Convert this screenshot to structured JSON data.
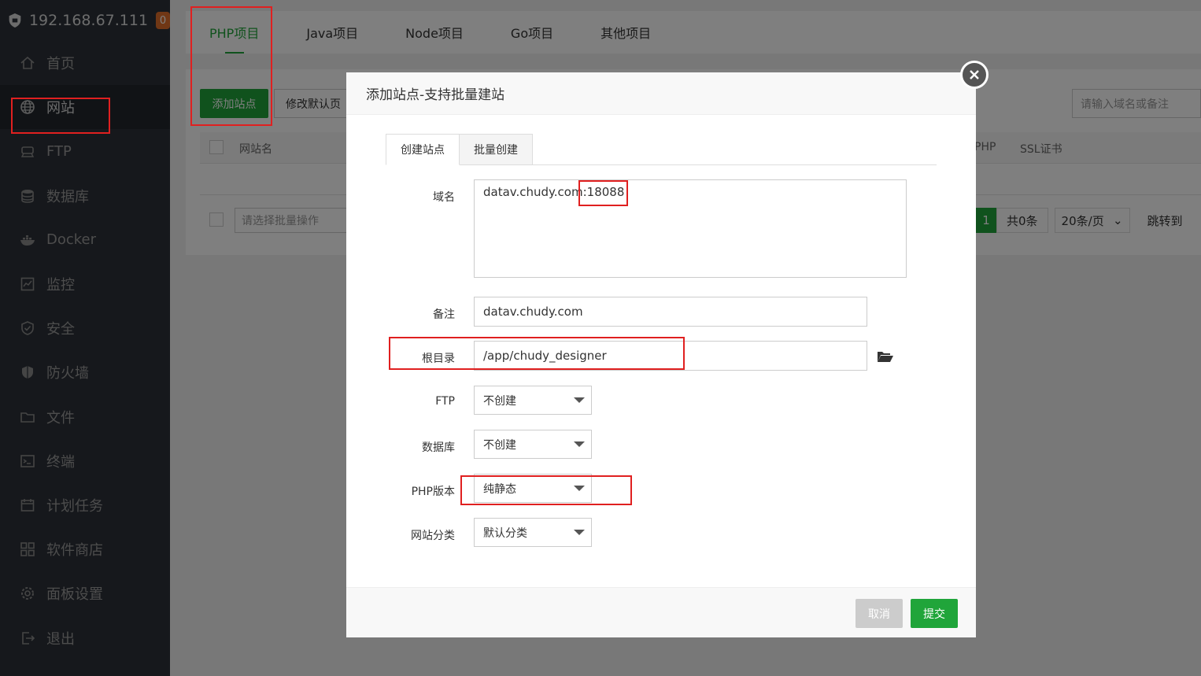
{
  "sidebar": {
    "server_ip": "192.168.67.111",
    "badge": "0",
    "items": [
      {
        "label": "首页",
        "icon": "home-icon"
      },
      {
        "label": "网站",
        "icon": "globe-icon",
        "active": true
      },
      {
        "label": "FTP",
        "icon": "ftp-icon"
      },
      {
        "label": "数据库",
        "icon": "database-icon"
      },
      {
        "label": "Docker",
        "icon": "docker-icon"
      },
      {
        "label": "监控",
        "icon": "monitor-icon"
      },
      {
        "label": "安全",
        "icon": "shield-check-icon"
      },
      {
        "label": "防火墙",
        "icon": "firewall-icon"
      },
      {
        "label": "文件",
        "icon": "folder-icon"
      },
      {
        "label": "终端",
        "icon": "terminal-icon"
      },
      {
        "label": "计划任务",
        "icon": "calendar-icon"
      },
      {
        "label": "软件商店",
        "icon": "apps-icon"
      },
      {
        "label": "面板设置",
        "icon": "gear-icon"
      },
      {
        "label": "退出",
        "icon": "logout-icon"
      }
    ]
  },
  "project_tabs": [
    "PHP项目",
    "Java项目",
    "Node项目",
    "Go项目",
    "其他项目"
  ],
  "toolbar": {
    "add_site": "添加站点",
    "edit_default": "修改默认页",
    "search_placeholder": "请输入域名或备注"
  },
  "table": {
    "col_name": "网站名",
    "col_php": "PHP",
    "col_ssl": "SSL证书"
  },
  "footer": {
    "batch_placeholder": "请选择批量操作",
    "page": "1",
    "total": "共0条",
    "page_size": "20条/页",
    "jump": "跳转到"
  },
  "modal": {
    "title": "添加站点-支持批量建站",
    "tabs": [
      "创建站点",
      "批量创建"
    ],
    "labels": {
      "domain": "域名",
      "remark": "备注",
      "root": "根目录",
      "ftp": "FTP",
      "database": "数据库",
      "php": "PHP版本",
      "category": "网站分类"
    },
    "values": {
      "domain": "datav.chudy.com",
      "port": ":18088",
      "remark": "datav.chudy.com",
      "root": "/app/chudy_designer",
      "ftp": "不创建",
      "database": "不创建",
      "php": "纯静态",
      "category": "默认分类"
    },
    "cancel": "取消",
    "submit": "提交"
  },
  "colors": {
    "sidebar_bg": "#2c3138",
    "accent_green": "#20a53a",
    "highlight_red": "#e02020"
  }
}
